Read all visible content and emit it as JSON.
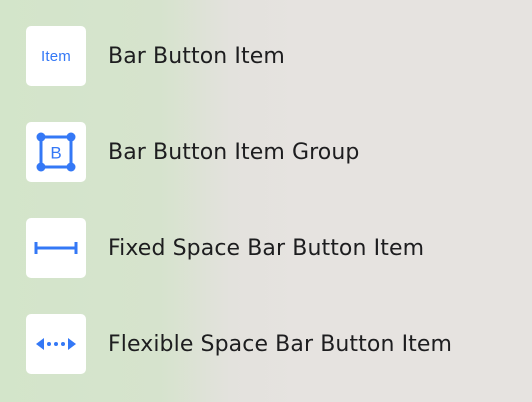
{
  "library": {
    "items": [
      {
        "label": "Bar Button Item",
        "icon": "item-text-icon",
        "icon_text": "Item"
      },
      {
        "label": "Bar Button Item Group",
        "icon": "group-b-icon",
        "icon_text": "B"
      },
      {
        "label": "Fixed Space Bar Button Item",
        "icon": "fixed-space-icon"
      },
      {
        "label": "Flexible Space Bar Button Item",
        "icon": "flexible-space-icon"
      }
    ]
  },
  "colors": {
    "accent": "#3478f6",
    "tile": "#ffffff",
    "text": "#1d1d1f"
  }
}
